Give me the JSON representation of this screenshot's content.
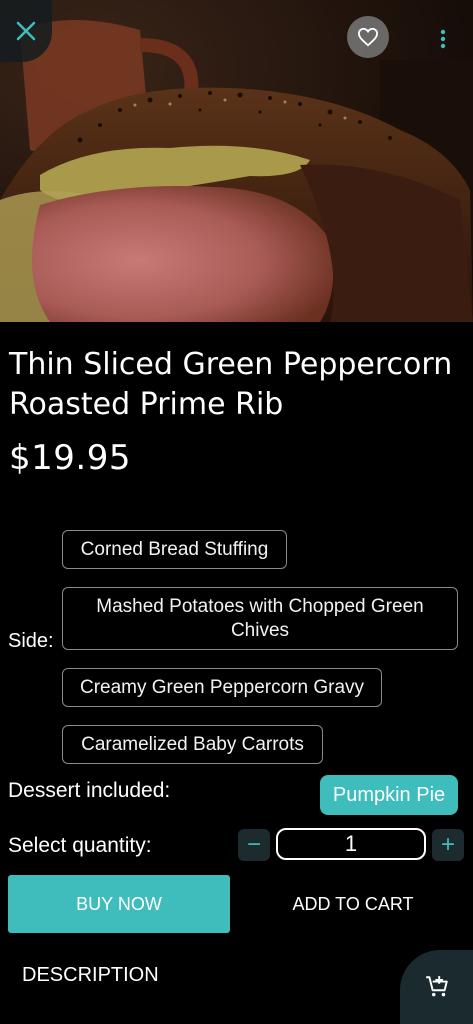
{
  "product": {
    "title": "Thin Sliced Green Peppercorn Roasted Prime Rib",
    "price": "$19.95",
    "image_subject": "roasted prime rib with herb crust"
  },
  "header": {
    "close_icon": "close-icon",
    "favorite_icon": "heart-outline-icon",
    "more_icon": "more-vertical-icon"
  },
  "side": {
    "label": "Side:",
    "options": [
      "Corned Bread Stuffing",
      "Mashed Potatoes with Chopped Green Chives",
      "Creamy Green Peppercorn Gravy",
      "Caramelized Baby Carrots"
    ]
  },
  "dessert": {
    "label": "Dessert included:",
    "selected": "Pumpkin Pie"
  },
  "quantity": {
    "label": "Select quantity:",
    "value": "1",
    "decrement": "−",
    "increment": "+"
  },
  "actions": {
    "buy_now": "BUY NOW",
    "add_to_cart": "ADD TO CART"
  },
  "tabs": {
    "description": "DESCRIPTION"
  },
  "fab": {
    "icon": "add-shopping-cart-icon"
  },
  "colors": {
    "accent": "#3fbcbc",
    "background": "#000000",
    "text": "#ffffff"
  }
}
